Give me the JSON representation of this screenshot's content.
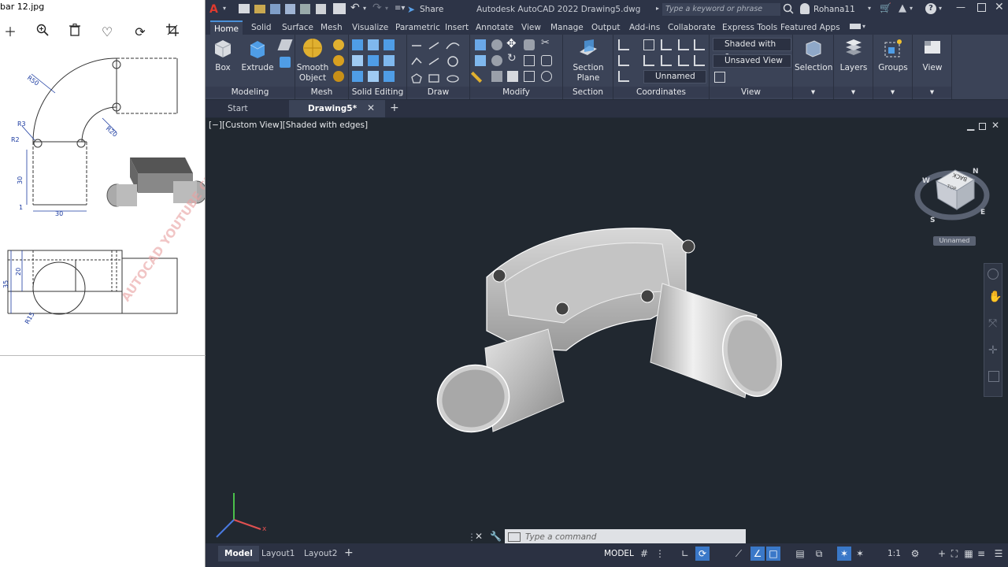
{
  "viewer": {
    "title": "bar 12.jpg",
    "tools": [
      "add-icon",
      "zoom-in-icon",
      "delete-icon",
      "heart-icon",
      "rotate-icon",
      "crop-icon"
    ],
    "dimensions": [
      "R50",
      "R3",
      "R2",
      "30",
      "1",
      "30",
      "R20",
      "35",
      "20",
      "R15"
    ],
    "watermark": "AUTOCAD YOUTUBE CHANNEL"
  },
  "titlebar": {
    "share": "Share",
    "app_title": "Autodesk AutoCAD 2022  Drawing5.dwg",
    "search_placeholder": "Type a keyword or phrase",
    "user": "Rohana11"
  },
  "ribbon_tabs": [
    "Home",
    "Solid",
    "Surface",
    "Mesh",
    "Visualize",
    "Parametric",
    "Insert",
    "Annotate",
    "View",
    "Manage",
    "Output",
    "Add-ins",
    "Collaborate",
    "Express Tools",
    "Featured Apps"
  ],
  "ribbon": {
    "box": "Box",
    "extrude": "Extrude",
    "smooth_object": "Smooth Object",
    "section_plane": "Section Plane",
    "selection": "Selection",
    "layers": "Layers",
    "groups": "Groups",
    "view": "View",
    "visual_style": "Shaded with e...",
    "saved_view": "Unsaved View",
    "ucs": "Unnamed",
    "panels": {
      "modeling": "Modeling",
      "mesh": "Mesh",
      "solid_editing": "Solid Editing",
      "draw": "Draw",
      "modify": "Modify",
      "section": "Section",
      "coordinates": "Coordinates",
      "view": "View"
    }
  },
  "doc_tabs": {
    "start": "Start",
    "drawing": "Drawing5*"
  },
  "viewport": {
    "label": "[−][Custom View][Shaded with edges]",
    "viewcube_top": "TOP",
    "viewcube_back": "BACK",
    "compass": [
      "W",
      "N",
      "E",
      "S"
    ],
    "ucs_name": "Unnamed"
  },
  "command": {
    "placeholder": "Type a command"
  },
  "layout_tabs": [
    "Model",
    "Layout1",
    "Layout2"
  ],
  "status": {
    "model": "MODEL",
    "scale": "1:1"
  },
  "colors": {
    "accent": "#4a90d9",
    "ribbon": "#3b4357",
    "viewport": "#212830"
  }
}
